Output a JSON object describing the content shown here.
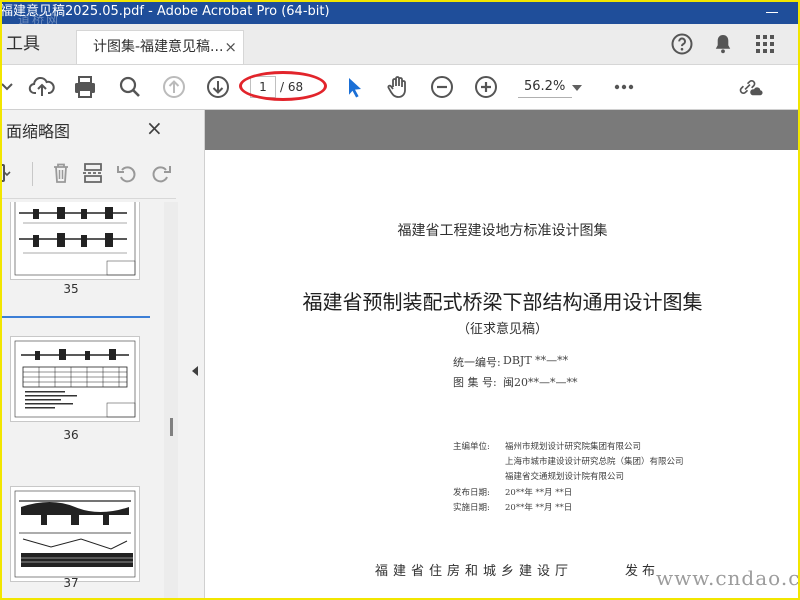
{
  "window": {
    "title": "福建意见稿2025.05.pdf - Adobe Acrobat Pro (64-bit)",
    "watermark_title": "道桥网"
  },
  "tabs": {
    "tools": "工具",
    "document": "计图集-福建意见稿...",
    "close": "×"
  },
  "toolbar": {
    "page_current": "1",
    "page_total": "/ 68",
    "zoom": "56.2%"
  },
  "sidebar": {
    "title": "面缩略图",
    "close": "×",
    "thumbnails": [
      {
        "page": "35"
      },
      {
        "page": "36"
      },
      {
        "page": "37"
      }
    ]
  },
  "document": {
    "series_title": "福建省工程建设地方标准设计图集",
    "main_title": "福建省预制装配式桥梁下部结构通用设计图集",
    "subtitle": "（征求意见稿）",
    "unified_no_label": "统一编号:",
    "unified_no_value": "DBJT **—**",
    "atlas_no_label": "图 集 号:",
    "atlas_no_value": "闽20**—*—**",
    "editor_label": "主编单位:",
    "editors": [
      "福州市规划设计研究院集团有限公司",
      "上海市城市建设设计研究总院（集团）有限公司",
      "福建省交通规划设计院有限公司"
    ],
    "release_label": "发布日期:",
    "release_value": "20**年 **月 **日",
    "implement_label": "实施日期:",
    "implement_value": "20**年 **月 **日",
    "publisher": "福建省住房和城乡建设厅",
    "publish_word": "发布"
  },
  "watermark": "www.cndao.com",
  "colors": {
    "title_bar": "#1f4e9a",
    "annotation": "#e2242b",
    "select_blue": "#3d7fd6",
    "frame": "#f2e600"
  }
}
